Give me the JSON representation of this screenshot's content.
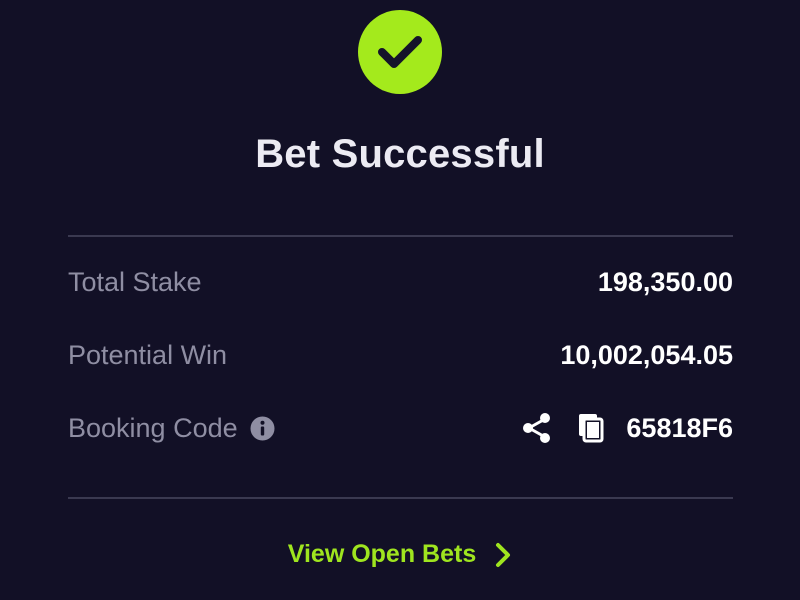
{
  "header": {
    "title": "Bet Successful",
    "status_icon": "check-circle-icon"
  },
  "summary": {
    "rows": [
      {
        "label": "Total Stake",
        "value": "198,350.00"
      },
      {
        "label": "Potential Win",
        "value": "10,002,054.05"
      },
      {
        "label": "Booking Code",
        "value": "65818F6"
      }
    ],
    "icons": {
      "info": "info-icon",
      "share": "share-icon",
      "copy": "copy-icon"
    }
  },
  "footer": {
    "link_label": "View Open Bets",
    "link_icon": "chevron-right-icon"
  },
  "colors": {
    "background": "#121026",
    "accent": "#a4ea1c",
    "link": "#9fe51f",
    "label": "#8f8ea3",
    "value": "#ffffff",
    "divider": "#3a3950"
  }
}
